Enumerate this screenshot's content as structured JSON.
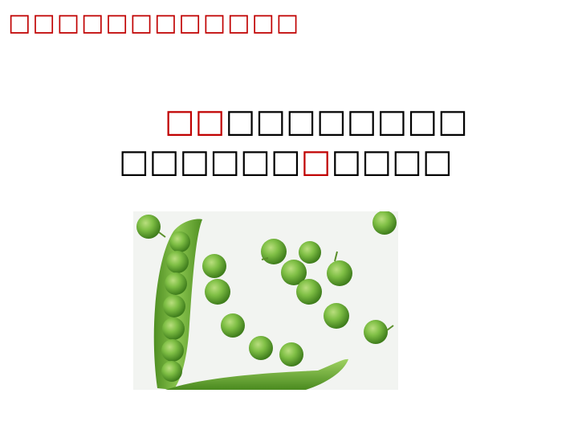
{
  "title": {
    "text": "□□□□□□□□□□□□",
    "color": "#c00000"
  },
  "verse": {
    "line1": {
      "red_part": "□□",
      "black_part": "□□□□□□□□"
    },
    "line2": {
      "black_before": "□□□□□□",
      "red_char": "□",
      "black_after": "□□□□"
    }
  },
  "image": {
    "subject": "green peas and pea pods",
    "colors": {
      "pea": "#6fae3a",
      "pea_highlight": "#a9d46e",
      "pod": "#7cb342",
      "background": "#f2f4f1"
    }
  }
}
